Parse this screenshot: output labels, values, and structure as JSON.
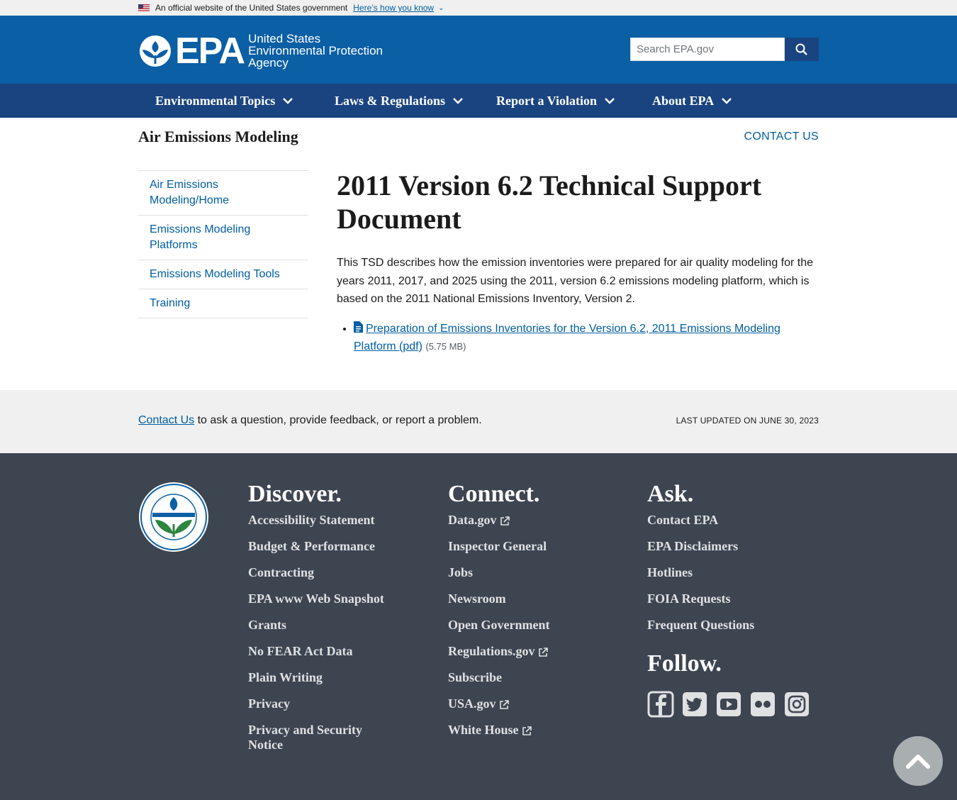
{
  "gov_banner": {
    "text": "An official website of the United States government",
    "link": "Here’s how you know"
  },
  "header": {
    "logo_text": "EPA",
    "agency_line1": "United States",
    "agency_line2": "Environmental Protection",
    "agency_line3": "Agency",
    "search_placeholder": "Search EPA.gov"
  },
  "nav": [
    "Environmental Topics",
    "Laws & Regulations",
    "Report a Violation",
    "About EPA"
  ],
  "subhead": {
    "title": "Air Emissions Modeling",
    "contact": "CONTACT US"
  },
  "sidenav": [
    "Air Emissions Modeling/Home",
    "Emissions Modeling Platforms",
    "Emissions Modeling Tools",
    "Training"
  ],
  "main": {
    "title": "2011 Version 6.2 Technical Support Document",
    "body": "This TSD describes how the emission inventories were prepared for air quality modeling for the years 2011, 2017, and 2025 using the 2011, version 6.2 emissions modeling platform, which is based on the 2011 National Emissions Inventory, Version 2.",
    "doc_link": "Preparation of Emissions Inventories for the Version 6.2, 2011 Emissions Modeling Platform (pdf)",
    "doc_size": "(5.75 MB)"
  },
  "footer_top": {
    "contact_link": "Contact Us",
    "contact_text": " to ask a question, provide feedback, or report a problem.",
    "updated": "LAST UPDATED ON JUNE 30, 2023"
  },
  "footer": {
    "discover": {
      "heading": "Discover.",
      "links": [
        "Accessibility Statement",
        "Budget & Performance",
        "Contracting",
        "EPA www Web Snapshot",
        "Grants",
        "No FEAR Act Data",
        "Plain Writing",
        "Privacy",
        "Privacy and Security Notice"
      ]
    },
    "connect": {
      "heading": "Connect.",
      "links": [
        "Data.gov",
        "Inspector General",
        "Jobs",
        "Newsroom",
        "Open Government",
        "Regulations.gov",
        "Subscribe",
        "USA.gov",
        "White House"
      ]
    },
    "ask": {
      "heading": "Ask.",
      "links": [
        "Contact EPA",
        "EPA Disclaimers",
        "Hotlines",
        "FOIA Requests",
        "Frequent Questions"
      ]
    },
    "follow": {
      "heading": "Follow."
    }
  },
  "colors": {
    "header_blue": "#0b5fa5",
    "nav_navy": "#1a4480",
    "link_blue": "#005ea2",
    "footer_dark": "#3d4551"
  }
}
